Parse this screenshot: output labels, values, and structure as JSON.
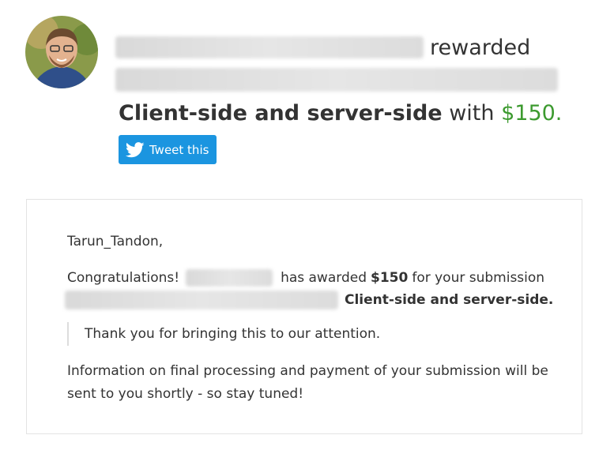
{
  "header": {
    "rewarded_word": "rewarded",
    "report_title": "Client-side and server-side",
    "with_word": "with",
    "amount": "$150."
  },
  "tweet": {
    "label": "Tweet this",
    "icon": "twitter-bird-icon"
  },
  "message": {
    "greeting": "Tarun_Tandon,",
    "congrats_prefix": "Congratulations!",
    "congrats_middle": "has awarded",
    "amount": "$150",
    "congrats_suffix": "for your submission",
    "submission_title": "Client-side and server-side.",
    "quote": "Thank you for bringing this to our attention.",
    "info_line1": "Information on final processing and payment of your submission will be",
    "info_line2": "sent to you shortly - so stay tuned!"
  },
  "colors": {
    "amount_green": "#3c9a2f",
    "tweet_blue": "#1b95e0"
  }
}
